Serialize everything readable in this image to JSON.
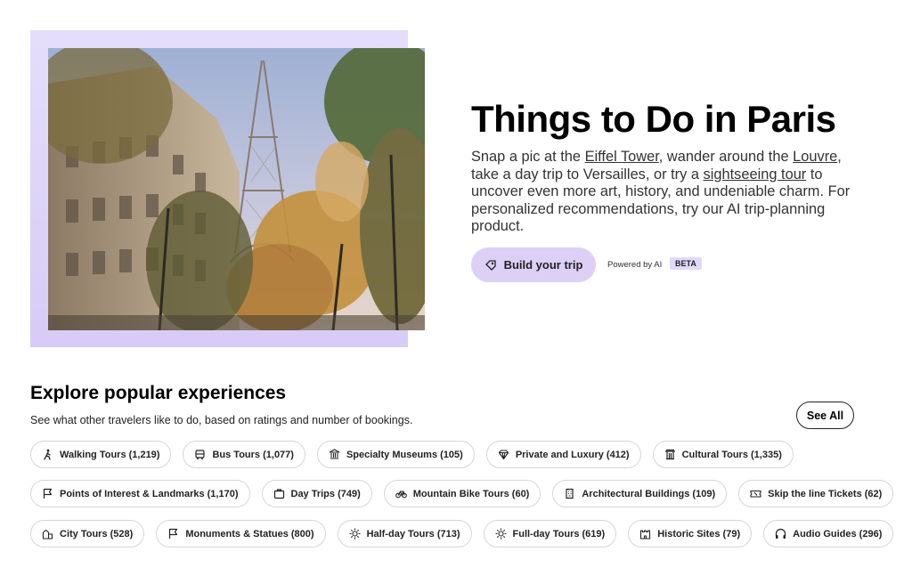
{
  "hero": {
    "title": "Things to Do in Paris",
    "desc_1": "Snap a pic at the ",
    "link_eiffel": "Eiffel Tower",
    "desc_2": ", wander around the ",
    "link_louvre": "Louvre",
    "desc_3": ", take a day trip to Versailles, or try a ",
    "link_sightseeing": "sightseeing tour",
    "desc_4": " to uncover even more art, history, and undeniable charm. For personalized recommendations, try our AI trip-planning product.",
    "build_button": "Build your trip",
    "powered_by": "Powered by AI",
    "beta": "BETA",
    "frame_color": "#dcd0f7"
  },
  "explore": {
    "title": "Explore popular experiences",
    "subtitle": "See what other travelers like to do, based on ratings and number of bookings.",
    "see_all": "See All",
    "rows": [
      [
        {
          "label": "Walking Tours (1,219)",
          "icon": "walking-icon"
        },
        {
          "label": "Bus Tours (1,077)",
          "icon": "bus-icon"
        },
        {
          "label": "Specialty Museums (105)",
          "icon": "museum-icon"
        },
        {
          "label": "Private and Luxury (412)",
          "icon": "diamond-icon"
        },
        {
          "label": "Cultural Tours (1,335)",
          "icon": "temple-icon"
        }
      ],
      [
        {
          "label": "Points of Interest & Landmarks (1,170)",
          "icon": "flag-icon"
        },
        {
          "label": "Day Trips (749)",
          "icon": "suitcase-icon"
        },
        {
          "label": "Mountain Bike Tours (60)",
          "icon": "bike-icon"
        },
        {
          "label": "Architectural Buildings (109)",
          "icon": "building-icon"
        },
        {
          "label": "Skip the line Tickets (62)",
          "icon": "ticket-icon"
        }
      ],
      [
        {
          "label": "City Tours (528)",
          "icon": "city-icon"
        },
        {
          "label": "Monuments & Statues (800)",
          "icon": "flag-icon"
        },
        {
          "label": "Half-day Tours (713)",
          "icon": "sun-icon"
        },
        {
          "label": "Full-day Tours (619)",
          "icon": "sun-icon"
        },
        {
          "label": "Historic Sites (79)",
          "icon": "castle-icon"
        },
        {
          "label": "Audio Guides (296)",
          "icon": "headphones-icon"
        }
      ]
    ]
  }
}
